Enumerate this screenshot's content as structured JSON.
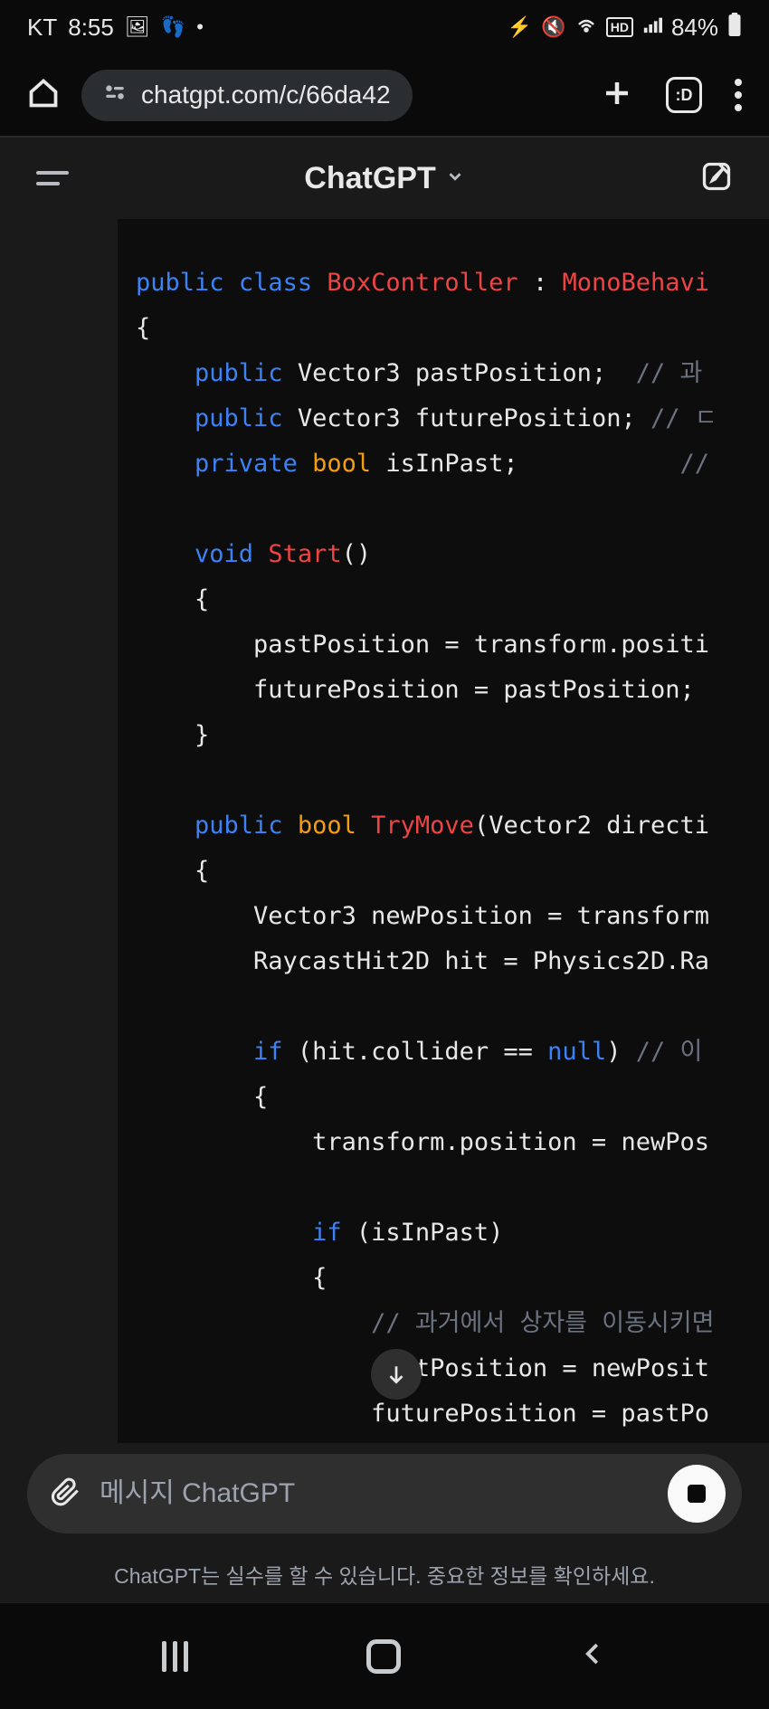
{
  "status": {
    "carrier": "KT",
    "time": "8:55",
    "battery": "84%"
  },
  "browser": {
    "url": "chatgpt.com/c/66da42",
    "tabs_badge": ":D"
  },
  "app": {
    "title": "ChatGPT"
  },
  "code": {
    "l1_kw1": "public",
    "l1_kw2": "class",
    "l1_name": "BoxController",
    "l1_colon": " : ",
    "l1_base": "MonoBehavi",
    "l2": "{",
    "l3_kw": "public",
    "l3_type": " Vector3 pastPosition;  ",
    "l3_cmt": "// 과",
    "l4_kw": "public",
    "l4_type": " Vector3 futurePosition; ",
    "l4_cmt": "// ㄷ",
    "l5_kw": "private",
    "l5_bool": "bool",
    "l5_rest": " isInPast;           ",
    "l5_cmt": "//",
    "l6_kw": "void",
    "l6_name": "Start",
    "l6_paren": "()",
    "l7": "{",
    "l8": "pastPosition = transform.positi",
    "l9": "futurePosition = pastPosition;",
    "l10": "}",
    "l11_kw": "public",
    "l11_bool": "bool",
    "l11_name": "TryMove",
    "l11_paren": "(Vector2 directi",
    "l12": "{",
    "l13": "Vector3 newPosition = transform",
    "l14": "RaycastHit2D hit = Physics2D.Ra",
    "l15_if": "if",
    "l15_cond": " (hit.collider == ",
    "l15_null": "null",
    "l15_paren": ") ",
    "l15_cmt": "// 이",
    "l16": "{",
    "l17": "transform.position = newPos",
    "l18_if": "if",
    "l18_cond": " (isInPast)",
    "l19": "{",
    "l20_cmt": "// 과거에서 상자를 이동시키면",
    "l21": "astPosition = newPosit",
    "l22": "futurePosition = pastPo"
  },
  "input": {
    "placeholder": "메시지 ChatGPT"
  },
  "disclaimer": "ChatGPT는 실수를 할 수 있습니다. 중요한 정보를 확인하세요."
}
